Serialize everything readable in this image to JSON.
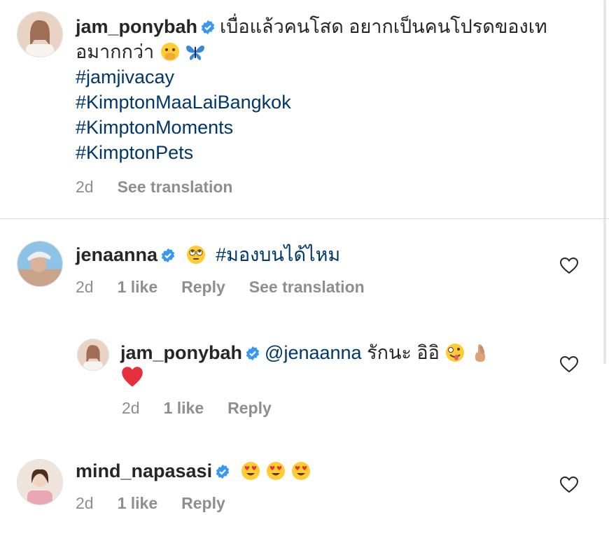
{
  "caption": {
    "username": "jam_ponybah",
    "text_line1": "เบื่อแล้วคนโสด อยากเป็นคนโปรดของเท",
    "text_line2": "อมากกว่า",
    "hashtags": [
      "#jamjivacay",
      "#KimptonMaaLaiBangkok",
      "#KimptonMoments",
      "#KimptonPets"
    ],
    "time": "2d",
    "see_translation": "See translation"
  },
  "comments": [
    {
      "username": "jenaanna",
      "hashtag": "#มองบนได้ไหม",
      "time": "2d",
      "likes": "1 like",
      "reply": "Reply",
      "see_translation": "See translation"
    },
    {
      "username": "jam_ponybah",
      "mention": "@jenaanna",
      "text": "รักนะ อิอิ",
      "time": "2d",
      "likes": "1 like",
      "reply": "Reply"
    },
    {
      "username": "mind_napasasi",
      "time": "2d",
      "likes": "1 like",
      "reply": "Reply"
    }
  ],
  "icons": {
    "verified": "verified-badge-icon",
    "heart": "heart-outline-icon"
  },
  "colors": {
    "text": "#262626",
    "secondary": "#8e8e8e",
    "link": "#00376b",
    "verified": "#3897f0"
  }
}
